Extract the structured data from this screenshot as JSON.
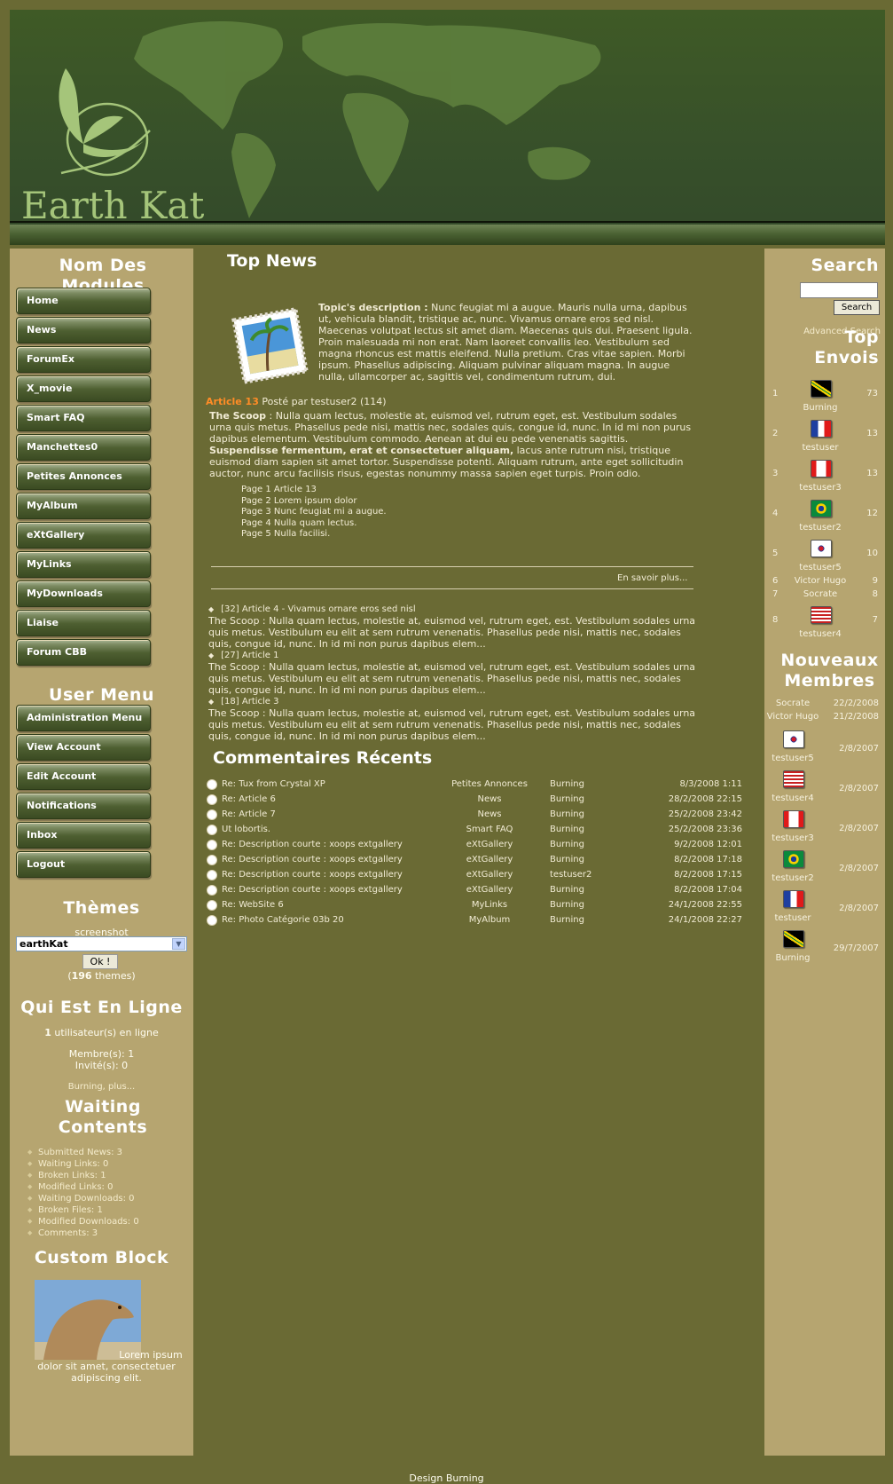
{
  "header": {
    "logo_text": "Earth Kat"
  },
  "left": {
    "modules_title": "Nom Des Modules",
    "modules": [
      "Home",
      "News",
      "ForumEx",
      "X_movie",
      "Smart FAQ",
      "Manchettes0",
      "Petites Annonces",
      "MyAlbum",
      "eXtGallery",
      "MyLinks",
      "MyDownloads",
      "Liaise",
      "Forum CBB"
    ],
    "user_menu_title": "User Menu",
    "user_menu": [
      "Administration Menu",
      "View Account",
      "Edit Account",
      "Notifications",
      "Inbox",
      "Logout"
    ],
    "themes_title": "Thèmes",
    "themes_screenshot": "screenshot",
    "themes_selected": "earthKat",
    "themes_ok": "Ok !",
    "themes_count_open": "(",
    "themes_count_num": "196",
    "themes_count_rest": " themes)",
    "online_title": "Qui Est En Ligne",
    "online_count": "1",
    "online_count_text": " utilisateur(s) en ligne",
    "online_members": "Membre(s): 1",
    "online_guests": "Invité(s): 0",
    "online_names": "Burning, plus...",
    "waiting_title": "Waiting Contents",
    "waiting": [
      "Submitted News: 3",
      "Waiting Links: 0",
      "Broken Links: 1",
      "Modified Links: 0",
      "Waiting Downloads: 0",
      "Broken Files: 1",
      "Modified Downloads: 0",
      "Comments: 3"
    ],
    "custom_title": "Custom Block",
    "custom_text": "Lorem ipsum dolor sit amet, consectetuer adipiscing elit."
  },
  "center": {
    "top_news_title": "Top News",
    "topic_label": "Topic's description :",
    "topic_text": " Nunc feugiat mi a augue. Mauris nulla urna, dapibus ut, vehicula blandit, tristique ac, nunc. Vivamus ornare eros sed nisl. Maecenas volutpat lectus sit amet diam. Maecenas quis dui. Praesent ligula. Proin malesuada mi non erat. Nam laoreet convallis leo. Vestibulum sed magna rhoncus est mattis eleifend. Nulla pretium. Cras vitae sapien. Morbi ipsum. Phasellus adipiscing. Aliquam pulvinar aliquam magna. In augue nulla, ullamcorper ac, sagittis vel, condimentum rutrum, dui.",
    "article_title": "Article 13",
    "article_meta": " Posté par testuser2 (114)",
    "scoop_label": "The Scoop",
    "scoop_text": " : Nulla quam lectus, molestie at, euismod vel, rutrum eget, est. Vestibulum sodales urna quis metus. Phasellus pede nisi, mattis nec, sodales quis, congue id, nunc. In id mi non purus dapibus elementum. Vestibulum commodo. Aenean at dui eu pede venenatis sagittis.",
    "scoop_bold": "Suspendisse fermentum, erat et consectetuer aliquam,",
    "scoop_text2": " lacus ante rutrum nisi, tristique euismod diam sapien sit amet tortor. Suspendisse potenti. Aliquam rutrum, ante eget sollicitudin auctor, nunc arcu facilisis risus, egestas nonummy massa sapien eget turpis. Proin odio.",
    "pages": [
      "Page 1 Article 13",
      "Page 2 Lorem ipsum dolor",
      "Page 3 Nunc feugiat mi a augue.",
      "Page 4 Nulla quam lectus.",
      "Page 5 Nulla facilisi."
    ],
    "read_more": "En savoir plus...",
    "other_articles": [
      {
        "title": "[32] Article 4 - Vivamus ornare eros sed nisl",
        "text": "The Scoop : Nulla quam lectus, molestie at, euismod vel, rutrum eget, est. Vestibulum sodales urna quis metus. Vestibulum eu elit at sem rutrum venenatis. Phasellus pede nisi, mattis nec, sodales quis, congue id, nunc. In id mi non purus dapibus elem..."
      },
      {
        "title": "[27] Article 1",
        "text": "The Scoop : Nulla quam lectus, molestie at, euismod vel, rutrum eget, est. Vestibulum sodales urna quis metus. Vestibulum eu elit at sem rutrum venenatis. Phasellus pede nisi, mattis nec, sodales quis, congue id, nunc. In id mi non purus dapibus elem..."
      },
      {
        "title": "[18] Article 3",
        "text": "The Scoop : Nulla quam lectus, molestie at, euismod vel, rutrum eget, est. Vestibulum sodales urna quis metus. Vestibulum eu elit at sem rutrum venenatis. Phasellus pede nisi, mattis nec, sodales quis, congue id, nunc. In id mi non purus dapibus elem..."
      }
    ],
    "comments_title": "Commentaires Récents",
    "comments": [
      {
        "title": "Re: Tux from Crystal XP",
        "module": "Petites Annonces",
        "user": "Burning",
        "date": "8/3/2008 1:11"
      },
      {
        "title": "Re: Article 6",
        "module": "News",
        "user": "Burning",
        "date": "28/2/2008 22:15"
      },
      {
        "title": "Re: Article 7",
        "module": "News",
        "user": "Burning",
        "date": "25/2/2008 23:42"
      },
      {
        "title": "Ut lobortis.",
        "module": "Smart FAQ",
        "user": "Burning",
        "date": "25/2/2008 23:36"
      },
      {
        "title": "Re: Description courte : xoops extgallery",
        "module": "eXtGallery",
        "user": "Burning",
        "date": "9/2/2008 12:01"
      },
      {
        "title": "Re: Description courte : xoops extgallery",
        "module": "eXtGallery",
        "user": "Burning",
        "date": "8/2/2008 17:18"
      },
      {
        "title": "Re: Description courte : xoops extgallery",
        "module": "eXtGallery",
        "user": "testuser2",
        "date": "8/2/2008 17:15"
      },
      {
        "title": "Re: Description courte : xoops extgallery",
        "module": "eXtGallery",
        "user": "Burning",
        "date": "8/2/2008 17:04"
      },
      {
        "title": "Re: WebSite 6",
        "module": "MyLinks",
        "user": "Burning",
        "date": "24/1/2008 22:55"
      },
      {
        "title": "Re: Photo Catégorie 03b 20",
        "module": "MyAlbum",
        "user": "Burning",
        "date": "24/1/2008 22:27"
      }
    ]
  },
  "right": {
    "search_title": "Search",
    "search_button": "Search",
    "advanced_search": "Advanced Search",
    "top_title": "Top Envois",
    "top": [
      {
        "rank": "1",
        "user": "Burning",
        "count": "73"
      },
      {
        "rank": "2",
        "user": "testuser",
        "count": "13"
      },
      {
        "rank": "3",
        "user": "testuser3",
        "count": "13"
      },
      {
        "rank": "4",
        "user": "testuser2",
        "count": "12"
      },
      {
        "rank": "5",
        "user": "testuser5",
        "count": "10"
      },
      {
        "rank": "6",
        "user": "Victor Hugo",
        "count": "9"
      },
      {
        "rank": "7",
        "user": "Socrate",
        "count": "8"
      },
      {
        "rank": "8",
        "user": "testuser4",
        "count": "7"
      }
    ],
    "new_title": "Nouveaux Membres",
    "new_members": [
      {
        "user": "Socrate",
        "date": "22/2/2008"
      },
      {
        "user": "Victor Hugo",
        "date": "21/2/2008"
      },
      {
        "user": "testuser5",
        "date": "2/8/2007"
      },
      {
        "user": "testuser4",
        "date": "2/8/2007"
      },
      {
        "user": "testuser3",
        "date": "2/8/2007"
      },
      {
        "user": "testuser2",
        "date": "2/8/2007"
      },
      {
        "user": "testuser",
        "date": "2/8/2007"
      },
      {
        "user": "Burning",
        "date": "29/7/2007"
      }
    ]
  },
  "footer": "Design Burning"
}
